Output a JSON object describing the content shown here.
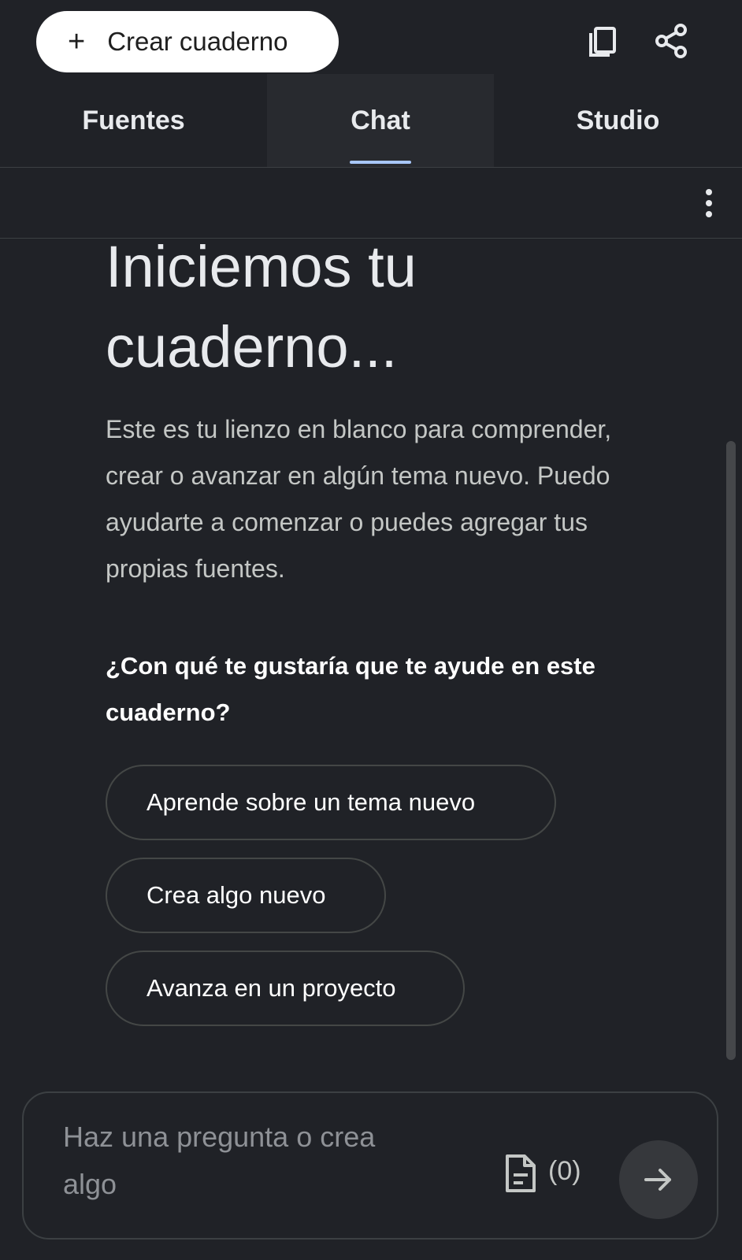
{
  "header": {
    "create_label": "Crear cuaderno",
    "create_plus": "+"
  },
  "tabs": [
    {
      "label": "Fuentes",
      "active": false
    },
    {
      "label": "Chat",
      "active": true
    },
    {
      "label": "Studio",
      "active": false
    }
  ],
  "main": {
    "heading": "Iniciemos tu cuaderno...",
    "intro": "Este es tu lienzo en blanco para comprender, crear o avanzar en algún tema nuevo. Puedo ayudarte a comenzar o puedes agregar tus propias fuentes.",
    "question": "¿Con qué te gustaría que te ayude en este cuaderno?",
    "suggestions": [
      "Aprende sobre un tema nuevo",
      "Crea algo nuevo",
      "Avanza en un proyecto"
    ]
  },
  "composer": {
    "placeholder": "Haz una pregunta o crea algo",
    "source_count": "(0)"
  },
  "icons": {
    "copy": "copy-icon",
    "share": "share-icon",
    "more": "more-vert-icon",
    "source": "document-icon",
    "send": "arrow-right-icon"
  },
  "colors": {
    "background": "#202227",
    "active_tab_bg": "#282a2f",
    "tab_indicator": "#a8c7fa",
    "create_button_bg": "#ffffff"
  }
}
